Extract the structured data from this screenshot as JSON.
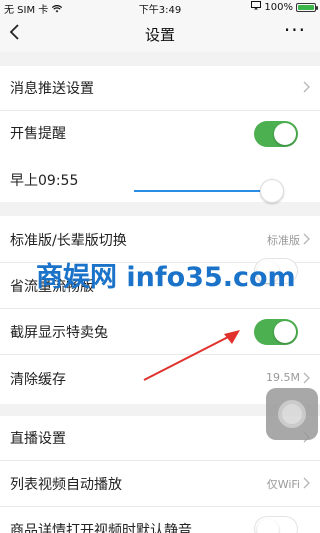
{
  "status_bar": {
    "carrier": "无 SIM 卡",
    "time": "下午3:49",
    "battery": "100%",
    "battery_level": 1.0
  },
  "nav": {
    "title": "设置",
    "more": "···"
  },
  "settings": {
    "push": {
      "label": "消息推送设置"
    },
    "sale_reminder": {
      "label": "开售提醒",
      "enabled": true
    },
    "reminder_time": {
      "label": "早上09:55",
      "slider_level": 0.93
    },
    "version_switch": {
      "label": "标准版/长辈版切换",
      "value": "标准版"
    },
    "data_saving": {
      "label": "省流量流畅版",
      "enabled": false
    },
    "screenshot_sale": {
      "label": "截屏显示特卖兔",
      "enabled": true
    },
    "clear_cache": {
      "label": "清除缓存",
      "value": "19.5M"
    },
    "live": {
      "label": "直播设置"
    },
    "autoplay": {
      "label": "列表视频自动播放",
      "value": "仅WiFi"
    },
    "mute_video": {
      "label": "商品详情打开视频时默认静音",
      "enabled": false
    }
  },
  "watermark": "商娱网 info35.com",
  "colors": {
    "toggle_on": "#4caf50",
    "slider_track": "#2b8ce6",
    "watermark": "#1a73c9",
    "annotation_arrow": "#e0312c"
  }
}
